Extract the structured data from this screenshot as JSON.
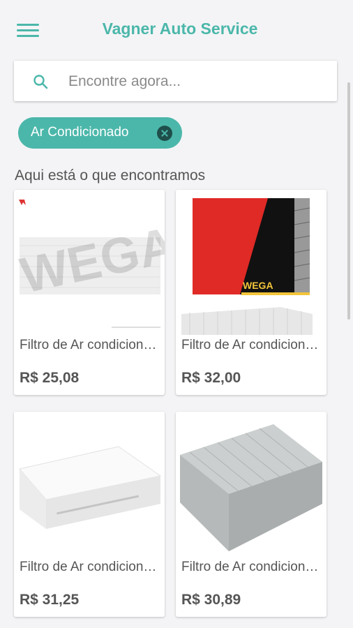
{
  "header": {
    "title": "Vagner Auto Service",
    "menu_icon": "menu-icon"
  },
  "search": {
    "placeholder": "Encontre agora...",
    "value": "",
    "icon": "search-icon"
  },
  "filter_chip": {
    "label": "Ar Condicionado",
    "close_icon": "close-icon"
  },
  "results": {
    "heading": "Aqui está o que encontramos",
    "products": [
      {
        "name": "Filtro de Ar condicionado",
        "price": "R$ 25,08"
      },
      {
        "name": "Filtro de Ar condicionado",
        "price": "R$ 32,00"
      },
      {
        "name": "Filtro de Ar condicionado",
        "price": "R$ 31,25"
      },
      {
        "name": "Filtro de Ar condicionado",
        "price": "R$ 30,89"
      }
    ]
  },
  "colors": {
    "accent": "#4bb7aa",
    "chip_close": "#1f4f4b",
    "box_red": "#e02a26"
  }
}
